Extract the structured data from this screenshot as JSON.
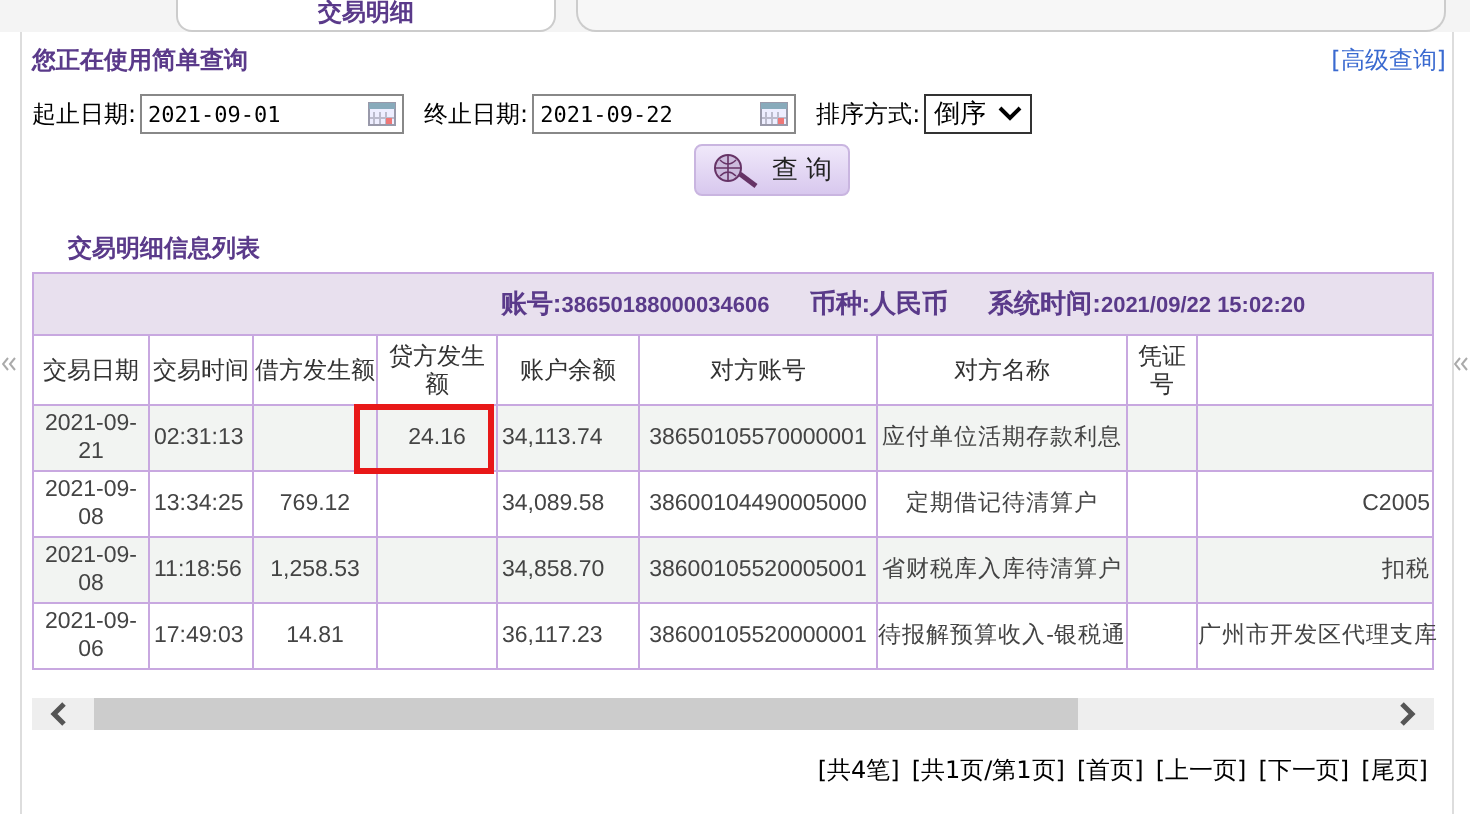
{
  "tab": {
    "label": "交易明细",
    "selected": true
  },
  "query": {
    "title": "您正在使用简单查询",
    "advanced_link": "[高级查询]",
    "start_label": "起止日期:",
    "start_value": "2021-09-01",
    "end_label": "终止日期:",
    "end_value": "2021-09-22",
    "sort_label": "排序方式:",
    "sort_value": "倒序",
    "search_button": "查 询"
  },
  "list": {
    "title": "交易明细信息列表",
    "account_label": "账号:",
    "account": "38650188000034606",
    "currency_label": "币种:",
    "currency": "人民币",
    "time_label": "系统时间:",
    "time": "2021/09/22 15:02:20"
  },
  "table": {
    "columns": [
      "交易日期",
      "交易时间",
      "借方发生额",
      "贷方发生额",
      "账户余额",
      "对方账号",
      "对方名称",
      "凭证号",
      ""
    ],
    "rows": [
      {
        "cells": [
          "2021-09-21",
          "02:31:13",
          "",
          "24.16",
          "34,113.74",
          "38650105570000001",
          "应付单位活期存款利息",
          "",
          ""
        ],
        "highlighted": true
      },
      {
        "cells": [
          "2021-09-08",
          "13:34:25",
          "769.12",
          "",
          "34,089.58",
          "38600104490005000",
          "定期借记待清算户",
          "",
          "C2005"
        ],
        "highlighted": false
      },
      {
        "cells": [
          "2021-09-08",
          "11:18:56",
          "1,258.53",
          "",
          "34,858.70",
          "38600105520005001",
          "省财税库入库待清算户",
          "",
          "扣税"
        ],
        "highlighted": false
      },
      {
        "cells": [
          "2021-09-06",
          "17:49:03",
          "14.81",
          "",
          "36,117.23",
          "38600105520000001",
          "待报解预算收入-银税通",
          "",
          "广州市开发区代理支库"
        ],
        "highlighted": false
      }
    ]
  },
  "pagination": [
    "[共4笔]",
    "[共1页/第1页]",
    "[首页]",
    "[上一页]",
    "[下一页]",
    "[尾页]"
  ]
}
